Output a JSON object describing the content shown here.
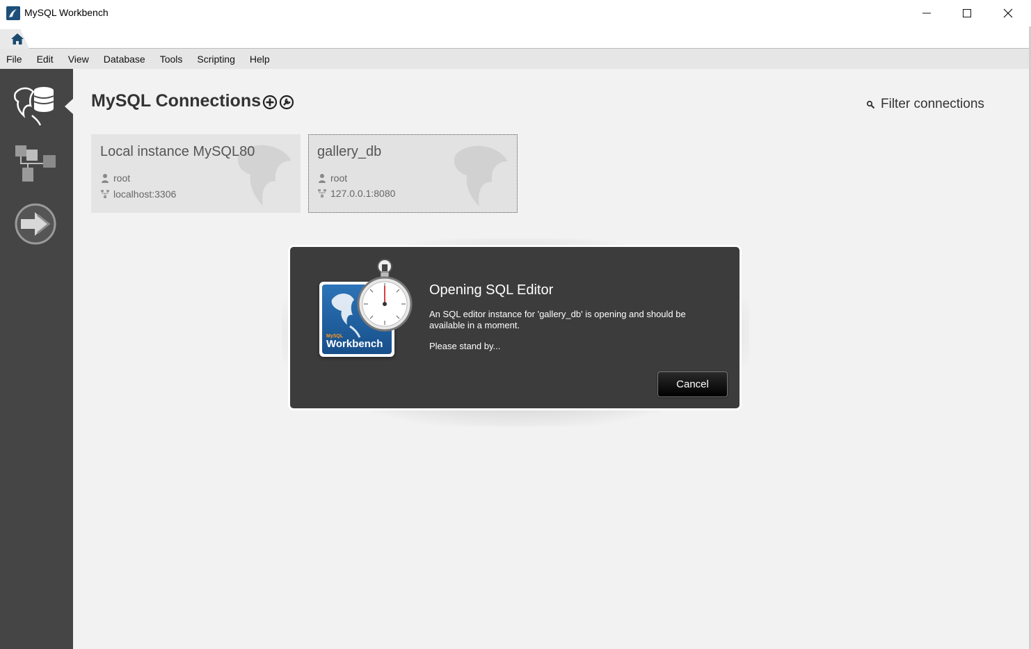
{
  "window": {
    "title": "MySQL Workbench",
    "controls": [
      "minimize",
      "maximize",
      "close"
    ]
  },
  "tabs": [
    {
      "icon": "home-icon"
    }
  ],
  "menu": {
    "items": [
      "File",
      "Edit",
      "View",
      "Database",
      "Tools",
      "Scripting",
      "Help"
    ]
  },
  "sidebar": {
    "items": [
      {
        "icon": "connections-icon",
        "active": true
      },
      {
        "icon": "models-icon",
        "active": false
      },
      {
        "icon": "migration-icon",
        "active": false
      }
    ]
  },
  "main": {
    "heading": "MySQL Connections",
    "filter_label": "Filter connections",
    "connections": [
      {
        "name": "Local instance MySQL80",
        "user": "root",
        "host": "localhost:3306",
        "selected": false
      },
      {
        "name": "gallery_db",
        "user": "root",
        "host": "127.0.0.1:8080",
        "selected": true
      }
    ]
  },
  "dialog": {
    "title": "Opening SQL Editor",
    "message": "An SQL editor instance for 'gallery_db' is opening and should be available in a moment.",
    "standby": "Please stand by...",
    "cancel_label": "Cancel",
    "logo_small": "MySQL",
    "logo_text": "Workbench"
  },
  "colors": {
    "sidebar_bg": "#454545",
    "dialog_bg": "#3c3c3c",
    "main_bg": "#f2f2f2"
  }
}
